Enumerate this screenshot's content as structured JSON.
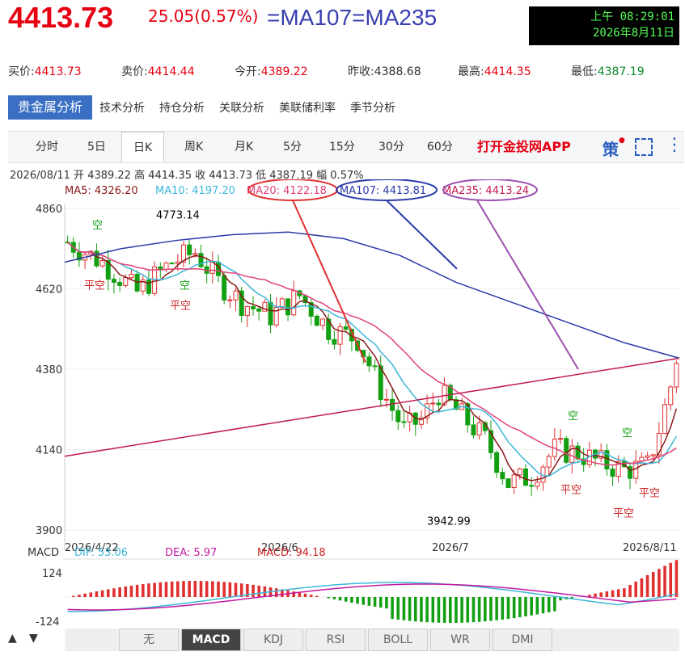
{
  "header": {
    "price": "4413.73",
    "change": "25.05(0.57%)",
    "ma_equation": "=MA107=MA235",
    "clock_line1": "上午 08:29:01",
    "clock_line2": "2026年8月11日"
  },
  "quote": [
    {
      "label": "买价:",
      "value": "4413.73",
      "tone": "up"
    },
    {
      "label": "卖价:",
      "value": "4414.44",
      "tone": "up"
    },
    {
      "label": "今开:",
      "value": "4389.22",
      "tone": "up"
    },
    {
      "label": "昨收:",
      "value": "4388.68",
      "tone": "flat"
    },
    {
      "label": "最高:",
      "value": "4414.35",
      "tone": "up"
    },
    {
      "label": "最低:",
      "value": "4387.19",
      "tone": "down"
    }
  ],
  "tabs": [
    "贵金属分析",
    "技术分析",
    "持仓分析",
    "关联分析",
    "美联储利率",
    "季节分析"
  ],
  "periods": [
    "分时",
    "5日",
    "日K",
    "周K",
    "月K",
    "5分",
    "15分",
    "30分",
    "60分"
  ],
  "active_period": "日K",
  "app_button": "打开金投网APP",
  "ohlc_line": "2026/08/11  开 4389.22  高 4414.35  收 4413.73  低 4387.19  幅 0.57%",
  "ma_labels": [
    {
      "text": "MA5: 4326.20",
      "color": "#8b1a1a"
    },
    {
      "text": "MA10: 4197.20",
      "color": "#3bb6d8"
    },
    {
      "text": "MA20: 4122.18",
      "color": "#e2427a"
    },
    {
      "text": "MA107: 4413.81",
      "color": "#2a3aa8"
    },
    {
      "text": "MA235: 4413.24",
      "color": "#c21a52"
    }
  ],
  "macd_labels": {
    "name": "MACD",
    "dif": "DIF: 53.06",
    "dea": "DEA: 5.97",
    "macd": "MACD: 94.18"
  },
  "indicator_tabs": [
    "无",
    "MACD",
    "KDJ",
    "RSI",
    "BOLL",
    "WR",
    "DMI"
  ],
  "active_indicator": "MACD",
  "chart_data": {
    "type": "candlestick",
    "yticks": [
      "4860",
      "4620",
      "4380",
      "4140",
      "3900"
    ],
    "ylim": [
      3890,
      4875
    ],
    "xticks": [
      "2026/4/22",
      "2026/6",
      "2026/7",
      "2026/8/11"
    ],
    "high_label": "4773.14",
    "low_label": "3942.99",
    "macd_yticks": [
      "124",
      "-124"
    ],
    "annotations_air": [
      "空",
      "空",
      "空",
      "空"
    ],
    "annotations_flat": [
      "平空",
      "平空",
      "平空",
      "平空",
      "平空"
    ],
    "colors": {
      "up": "#e03030",
      "down": "#12a012"
    }
  }
}
